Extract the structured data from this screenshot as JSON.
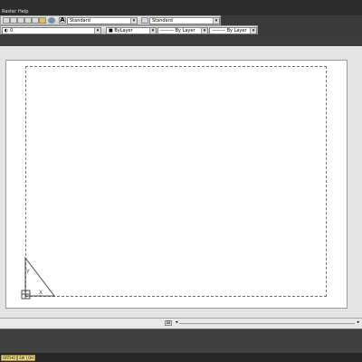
{
  "menubar": {
    "items": [
      "Raster",
      "Help"
    ]
  },
  "toolbar": {
    "text_style": "Standard",
    "dim_style": "Standard",
    "layer": "0",
    "color": "ByLayer",
    "linetype": "By Layer",
    "lineweight": "By Layer",
    "plot_style": "ByLayer"
  },
  "ucs": {
    "x_label": "X",
    "y_label": "Y"
  },
  "statusbar": {
    "buttons": [
      "ORTHO",
      "SW",
      "OH"
    ]
  },
  "colors": {
    "menubar_bg": "#2c2c2c",
    "status_active": "#f0dc93",
    "canvas_bg": "#ffffff",
    "paper_border": "#6e6e6e"
  }
}
